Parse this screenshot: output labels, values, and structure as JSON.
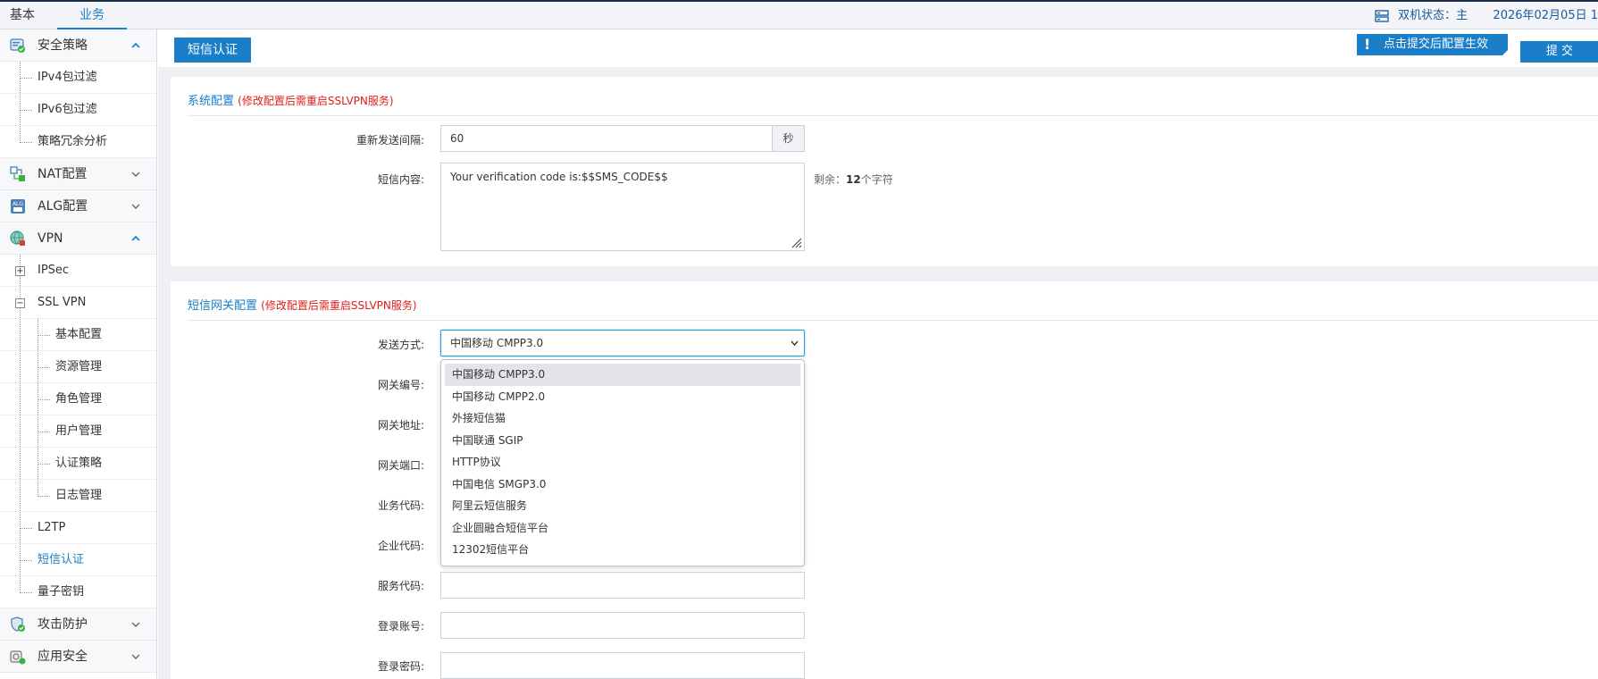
{
  "topbar": {
    "tabs": [
      {
        "label": "基本"
      },
      {
        "label": "业务"
      }
    ],
    "ha_status": "双机状态：主",
    "date": "2026年02月05日  1"
  },
  "sidebar": {
    "groups": [
      {
        "label": "安全策略",
        "icon": "shield-policy-icon",
        "items": [
          "IPv4包过滤",
          "IPv6包过滤",
          "策略冗余分析"
        ]
      },
      {
        "label": "NAT配置",
        "icon": "nat-icon"
      },
      {
        "label": "ALG配置",
        "icon": "alg-icon"
      },
      {
        "label": "VPN",
        "icon": "vpn-globe-icon"
      },
      {
        "label": "攻击防护",
        "icon": "attack-defense-icon"
      },
      {
        "label": "应用安全",
        "icon": "app-security-icon"
      }
    ],
    "vpn_items": {
      "ipsec": "IPSec",
      "sslvpn": "SSL VPN",
      "sslvpn_children": [
        "基本配置",
        "资源管理",
        "角色管理",
        "用户管理",
        "认证策略",
        "日志管理"
      ],
      "l2tp": "L2TP",
      "sms": "短信认证",
      "quantum": "量子密钥"
    }
  },
  "main": {
    "tab": "短信认证",
    "notice": "点击提交后配置生效",
    "submit": "提 交",
    "system_config": {
      "title": "系统配置",
      "warn": "(修改配置后需重启SSLVPN服务)",
      "resend_label": "重新发送间隔:",
      "resend_value": "60",
      "resend_unit": "秒",
      "content_label": "短信内容:",
      "content_value": "Your verification code is:$$SMS_CODE$$",
      "remain_prefix": "剩余：",
      "remain_count": "12",
      "remain_suffix": "个字符"
    },
    "gateway_config": {
      "title": "短信网关配置",
      "warn": "(修改配置后需重启SSLVPN服务)",
      "send_label": "发送方式:",
      "send_value": "中国移动 CMPP3.0",
      "options": [
        "中国移动 CMPP3.0",
        "中国移动 CMPP2.0",
        "外接短信猫",
        "中国联通 SGIP",
        "HTTP协议",
        "中国电信 SMGP3.0",
        "阿里云短信服务",
        "企业圆融合短信平台",
        "12302短信平台"
      ],
      "labels": {
        "gw_no": "网关编号:",
        "gw_addr": "网关地址:",
        "gw_port": "网关端口:",
        "biz_code": "业务代码:",
        "corp_code": "企业代码:",
        "svc_code": "服务代码:",
        "login_acct": "登录账号:",
        "login_pwd": "登录密码:"
      }
    }
  },
  "colors": {
    "accent": "#1a7ec9",
    "warn": "#e01d1d",
    "navy": "#1b2a4a"
  }
}
